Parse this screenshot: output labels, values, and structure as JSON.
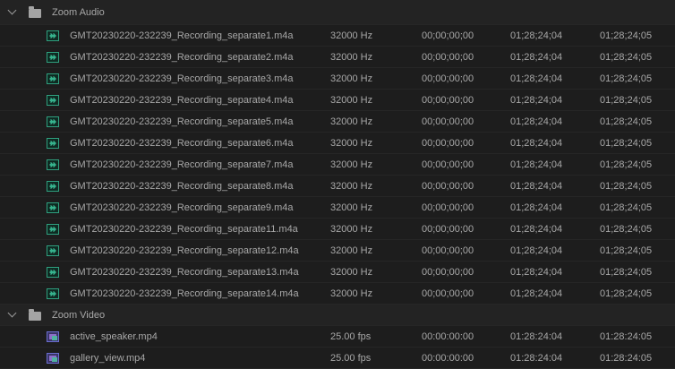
{
  "bins": [
    {
      "name": "Zoom Audio",
      "icon": "folder-icon",
      "expanded": true,
      "items": [
        {
          "name": "GMT20230220-232239_Recording_separate1.m4a",
          "icon": "audio-clip-icon",
          "rate": "32000 Hz",
          "start": "00;00;00;00",
          "end": "01;28;24;04",
          "duration": "01;28;24;05"
        },
        {
          "name": "GMT20230220-232239_Recording_separate2.m4a",
          "icon": "audio-clip-icon",
          "rate": "32000 Hz",
          "start": "00;00;00;00",
          "end": "01;28;24;04",
          "duration": "01;28;24;05"
        },
        {
          "name": "GMT20230220-232239_Recording_separate3.m4a",
          "icon": "audio-clip-icon",
          "rate": "32000 Hz",
          "start": "00;00;00;00",
          "end": "01;28;24;04",
          "duration": "01;28;24;05"
        },
        {
          "name": "GMT20230220-232239_Recording_separate4.m4a",
          "icon": "audio-clip-icon",
          "rate": "32000 Hz",
          "start": "00;00;00;00",
          "end": "01;28;24;04",
          "duration": "01;28;24;05"
        },
        {
          "name": "GMT20230220-232239_Recording_separate5.m4a",
          "icon": "audio-clip-icon",
          "rate": "32000 Hz",
          "start": "00;00;00;00",
          "end": "01;28;24;04",
          "duration": "01;28;24;05"
        },
        {
          "name": "GMT20230220-232239_Recording_separate6.m4a",
          "icon": "audio-clip-icon",
          "rate": "32000 Hz",
          "start": "00;00;00;00",
          "end": "01;28;24;04",
          "duration": "01;28;24;05"
        },
        {
          "name": "GMT20230220-232239_Recording_separate7.m4a",
          "icon": "audio-clip-icon",
          "rate": "32000 Hz",
          "start": "00;00;00;00",
          "end": "01;28;24;04",
          "duration": "01;28;24;05"
        },
        {
          "name": "GMT20230220-232239_Recording_separate8.m4a",
          "icon": "audio-clip-icon",
          "rate": "32000 Hz",
          "start": "00;00;00;00",
          "end": "01;28;24;04",
          "duration": "01;28;24;05"
        },
        {
          "name": "GMT20230220-232239_Recording_separate9.m4a",
          "icon": "audio-clip-icon",
          "rate": "32000 Hz",
          "start": "00;00;00;00",
          "end": "01;28;24;04",
          "duration": "01;28;24;05"
        },
        {
          "name": "GMT20230220-232239_Recording_separate11.m4a",
          "icon": "audio-clip-icon",
          "rate": "32000 Hz",
          "start": "00;00;00;00",
          "end": "01;28;24;04",
          "duration": "01;28;24;05"
        },
        {
          "name": "GMT20230220-232239_Recording_separate12.m4a",
          "icon": "audio-clip-icon",
          "rate": "32000 Hz",
          "start": "00;00;00;00",
          "end": "01;28;24;04",
          "duration": "01;28;24;05"
        },
        {
          "name": "GMT20230220-232239_Recording_separate13.m4a",
          "icon": "audio-clip-icon",
          "rate": "32000 Hz",
          "start": "00;00;00;00",
          "end": "01;28;24;04",
          "duration": "01;28;24;05"
        },
        {
          "name": "GMT20230220-232239_Recording_separate14.m4a",
          "icon": "audio-clip-icon",
          "rate": "32000 Hz",
          "start": "00;00;00;00",
          "end": "01;28;24;04",
          "duration": "01;28;24;05"
        }
      ]
    },
    {
      "name": "Zoom Video",
      "icon": "folder-icon",
      "expanded": true,
      "items": [
        {
          "name": "active_speaker.mp4",
          "icon": "video-clip-icon",
          "rate": "25.00 fps",
          "start": "00:00:00:00",
          "end": "01:28:24:04",
          "duration": "01:28:24:05"
        },
        {
          "name": "gallery_view.mp4",
          "icon": "video-clip-icon",
          "rate": "25.00 fps",
          "start": "00:00:00:00",
          "end": "01:28:24:04",
          "duration": "01:28:24:05"
        }
      ]
    }
  ],
  "colors": {
    "background": "#1d1d1d",
    "bin_row": "#232323",
    "text": "#a8a8a8",
    "audio_icon": "#2fa07f",
    "video_icon": "#6a6ed0"
  }
}
